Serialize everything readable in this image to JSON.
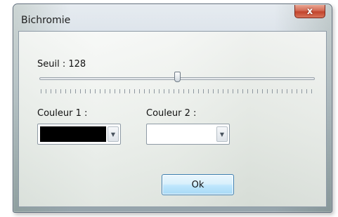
{
  "window": {
    "title": "Bichromie",
    "close_label": "x"
  },
  "threshold": {
    "label": "Seuil : 128",
    "value": 128,
    "min": 0,
    "max": 255
  },
  "color1": {
    "label": "Couleur 1 :",
    "value": "#000000"
  },
  "color2": {
    "label": "Couleur 2 :",
    "value": "#ffffff"
  },
  "icons": {
    "dropdown": "chevron-down-icon",
    "close": "close-icon"
  },
  "ok_button": {
    "label": "Ok"
  }
}
